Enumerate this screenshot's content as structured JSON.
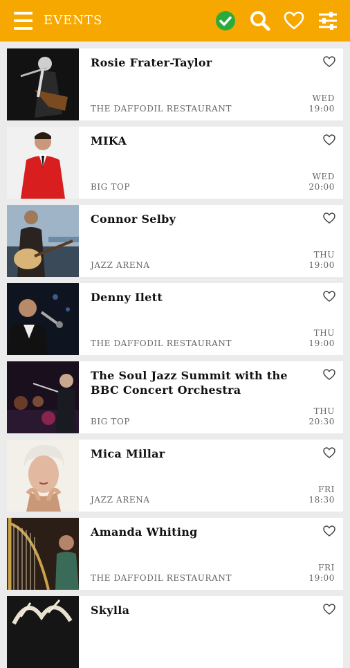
{
  "header": {
    "title": "EVENTS",
    "accent_color": "#f7a800",
    "icons": [
      "menu-icon",
      "check-circle-icon",
      "search-icon",
      "heart-icon",
      "sliders-icon"
    ]
  },
  "events": [
    {
      "name": "Rosie Frater-Taylor",
      "venue": "THE DAFFODIL RESTAURANT",
      "day": "WED",
      "time": "19:00"
    },
    {
      "name": "MIKA",
      "venue": "BIG TOP",
      "day": "WED",
      "time": "20:00"
    },
    {
      "name": "Connor Selby",
      "venue": "JAZZ ARENA",
      "day": "THU",
      "time": "19:00"
    },
    {
      "name": "Denny Ilett",
      "venue": "THE DAFFODIL RESTAURANT",
      "day": "THU",
      "time": "19:00"
    },
    {
      "name": "The Soul Jazz Summit with the BBC Concert Orchestra",
      "venue": "BIG TOP",
      "day": "THU",
      "time": "20:30"
    },
    {
      "name": "Mica Millar",
      "venue": "JAZZ ARENA",
      "day": "FRI",
      "time": "18:30"
    },
    {
      "name": "Amanda Whiting",
      "venue": "THE DAFFODIL RESTAURANT",
      "day": "FRI",
      "time": "19:00"
    },
    {
      "name": "Skylla",
      "venue": "",
      "day": "",
      "time": ""
    }
  ]
}
